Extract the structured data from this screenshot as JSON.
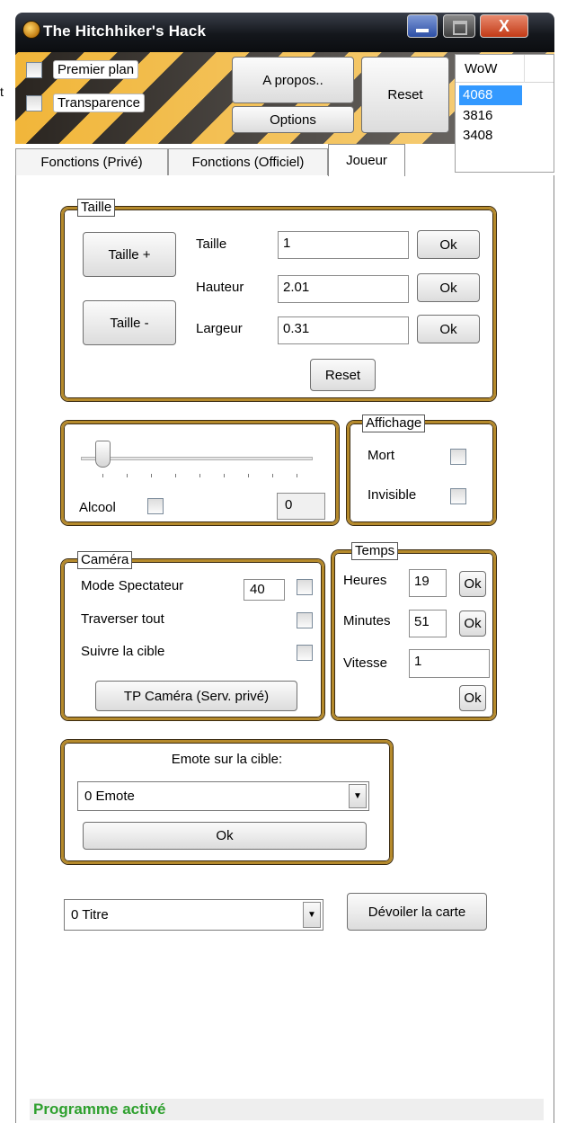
{
  "window": {
    "title": "The Hitchhiker's Hack",
    "close_glyph": "X"
  },
  "stray_text": "t",
  "header": {
    "premier_plan": "Premier plan",
    "transparence": "Transparence",
    "a_propos": "A propos..",
    "options": "Options",
    "reset": "Reset"
  },
  "wow_list": {
    "header": "WoW",
    "items": [
      "4068",
      "3816",
      "3408"
    ],
    "selected": "4068"
  },
  "tabs": [
    "Fonctions (Privé)",
    "Fonctions (Officiel)",
    "Joueur"
  ],
  "active_tab": "Joueur",
  "taille": {
    "legend": "Taille",
    "taille_plus": "Taille +",
    "taille_moins": "Taille -",
    "rows": [
      {
        "label": "Taille",
        "value": "1",
        "ok": "Ok"
      },
      {
        "label": "Hauteur",
        "value": "2.01",
        "ok": "Ok"
      },
      {
        "label": "Largeur",
        "value": "0.31",
        "ok": "Ok"
      }
    ],
    "reset": "Reset"
  },
  "alcool": {
    "label": "Alcool",
    "value": "0"
  },
  "affichage": {
    "legend": "Affichage",
    "mort": "Mort",
    "invisible": "Invisible"
  },
  "camera": {
    "legend": "Caméra",
    "mode_spectateur": "Mode Spectateur",
    "mode_value": "40",
    "traverser": "Traverser tout",
    "suivre": "Suivre la cible",
    "tp_button": "TP Caméra (Serv. privé)"
  },
  "temps": {
    "legend": "Temps",
    "heures": "Heures",
    "heures_value": "19",
    "minutes": "Minutes",
    "minutes_value": "51",
    "vitesse": "Vitesse",
    "vitesse_value": "1",
    "ok": "Ok"
  },
  "emote": {
    "title": "Emote sur la cible:",
    "selected": "0  Emote",
    "ok": "Ok"
  },
  "titre": {
    "selected": "0  Titre"
  },
  "devoiler": "Dévoiler la carte",
  "status": "Programme activé",
  "colors": {
    "accent_border": "#b58a2c",
    "status_text": "#2ea02e",
    "hazard_yellow": "#f1b63a",
    "selection": "#3399ff"
  }
}
